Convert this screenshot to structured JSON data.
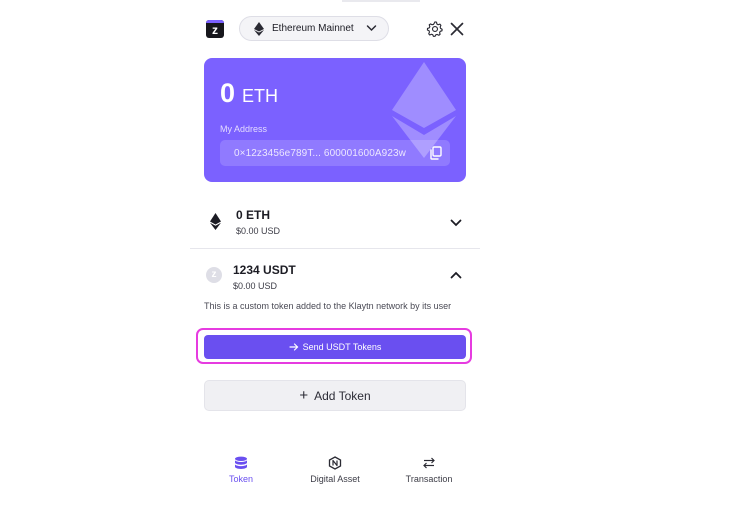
{
  "header": {
    "logo_letter": "z",
    "network_label": "Ethereum Mainnet"
  },
  "card": {
    "balance_amount": "0",
    "balance_unit": "ETH",
    "address_label": "My Address",
    "address": "0×12z3456e789T... 600001600A923w"
  },
  "tokens": [
    {
      "name": "0 ETH",
      "usd": "$0.00 USD",
      "expanded": false,
      "icon": "ethereum-icon"
    },
    {
      "name": "1234 USDT",
      "usd": "$0.00 USD",
      "expanded": true,
      "icon": "custom-token-icon",
      "description": "This is a custom token added to the Klaytn network by its user",
      "action_label": "Send USDT Tokens"
    }
  ],
  "add_token_label": "Add Token",
  "nav": [
    {
      "label": "Token",
      "icon": "coins-stack-icon",
      "active": true
    },
    {
      "label": "Digital Asset",
      "icon": "nft-hexagon-icon",
      "active": false
    },
    {
      "label": "Transaction",
      "icon": "swap-arrows-icon",
      "active": false
    }
  ],
  "colors": {
    "accent": "#7b61ff",
    "button": "#6a4ff0",
    "highlight": "#e63be0"
  }
}
